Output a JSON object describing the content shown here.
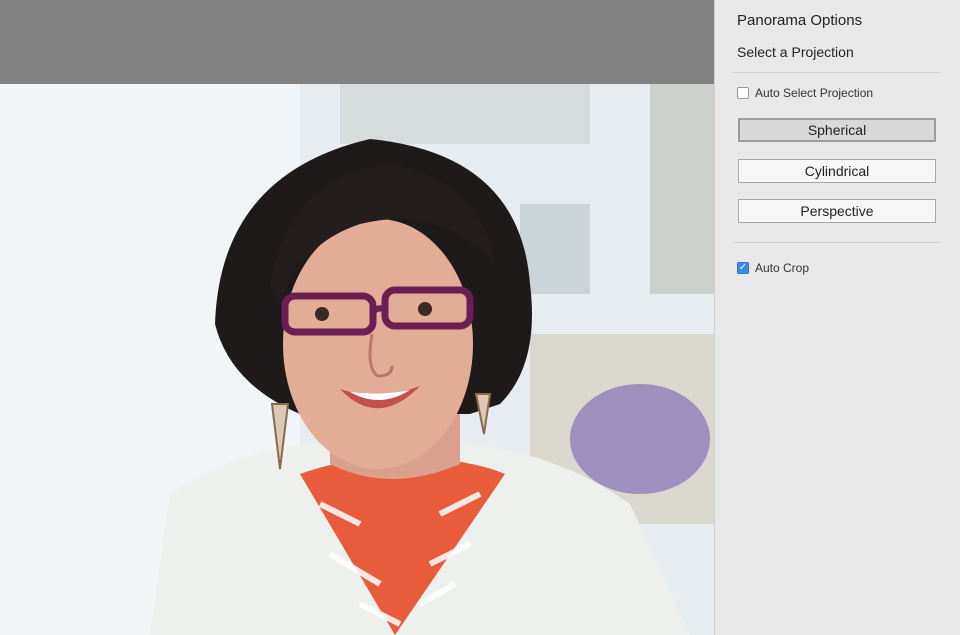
{
  "panel": {
    "title": "Panorama Options",
    "projection_heading": "Select a Projection",
    "auto_select": {
      "label": "Auto Select Projection",
      "checked": false
    },
    "projections": [
      {
        "label": "Spherical",
        "selected": true
      },
      {
        "label": "Cylindrical",
        "selected": false
      },
      {
        "label": "Perspective",
        "selected": false
      }
    ],
    "auto_crop": {
      "label": "Auto Crop",
      "checked": true
    }
  },
  "colors": {
    "panel_bg": "#e8e8e8",
    "checkbox_checked": "#3b89e8",
    "preview_bg": "#818181"
  }
}
